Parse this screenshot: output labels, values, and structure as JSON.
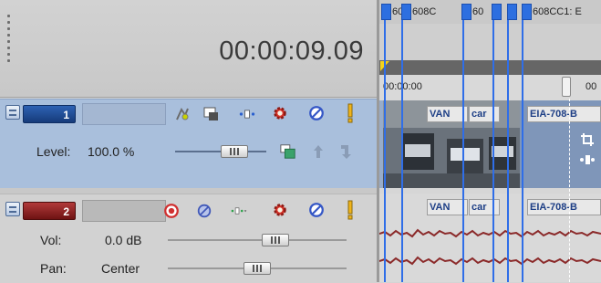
{
  "timecode": "00:00:09.09",
  "ruler": {
    "start": "00:00:00",
    "next": "00"
  },
  "marker_labels": [
    "60",
    "608C",
    "60",
    "608CC1: E"
  ],
  "video_track": {
    "number": "1",
    "level_label": "Level:",
    "level_value": "100.0 %",
    "level": 0.72,
    "color": "#1f4f9e"
  },
  "audio_track": {
    "number": "2",
    "vol_label": "Vol:",
    "vol_value": "0.0 dB",
    "vol_level": 0.62,
    "pan_label": "Pan:",
    "pan_value": "Center",
    "pan_level": 0.5,
    "color": "#8a1d1d"
  },
  "video_clips": [
    {
      "label": "VAN"
    },
    {
      "label": "car"
    },
    {
      "label": "EIA-708-B"
    }
  ],
  "audio_clips": [
    {
      "label": "VAN"
    },
    {
      "label": "car"
    },
    {
      "label": "EIA-708-B"
    }
  ],
  "icons": {
    "fx": "fx-icon",
    "composite": "composite-mode-icon",
    "motion": "motion-icon",
    "settings": "gear-icon",
    "mute": "mute-icon",
    "solo": "solo-icon"
  }
}
